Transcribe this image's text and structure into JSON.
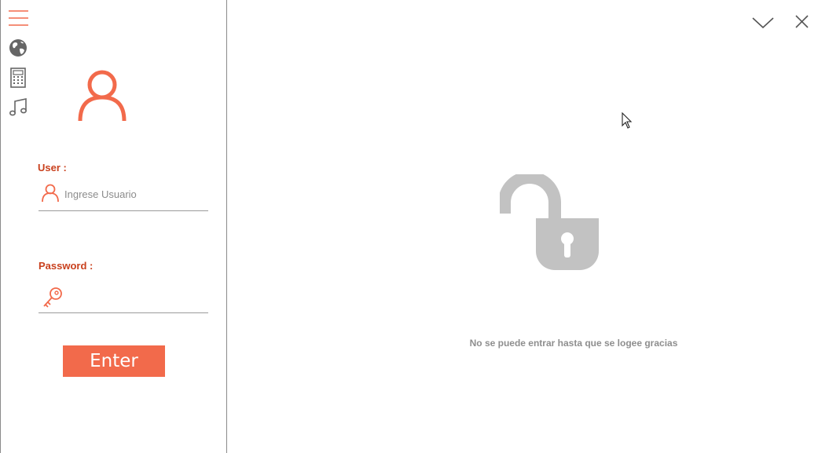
{
  "sidebar": {
    "menu_icon": "hamburger-menu-icon",
    "icons": [
      "globe-icon",
      "calculator-icon",
      "music-note-icon"
    ]
  },
  "login": {
    "user_label": "User  :",
    "user_placeholder": "Ingrese Usuario",
    "password_label": "Password :",
    "enter_label": "Enter"
  },
  "window_controls": {
    "minimize_icon": "chevron-down-icon",
    "close_icon": "close-icon"
  },
  "main": {
    "lock_icon": "unlocked-padlock-icon",
    "message": "No se puede entrar hasta que se logee gracias"
  },
  "colors": {
    "accent": "#f26a4b",
    "label": "#c9411e",
    "icon_gray": "#666666",
    "lock_gray": "#c2c2c2"
  }
}
